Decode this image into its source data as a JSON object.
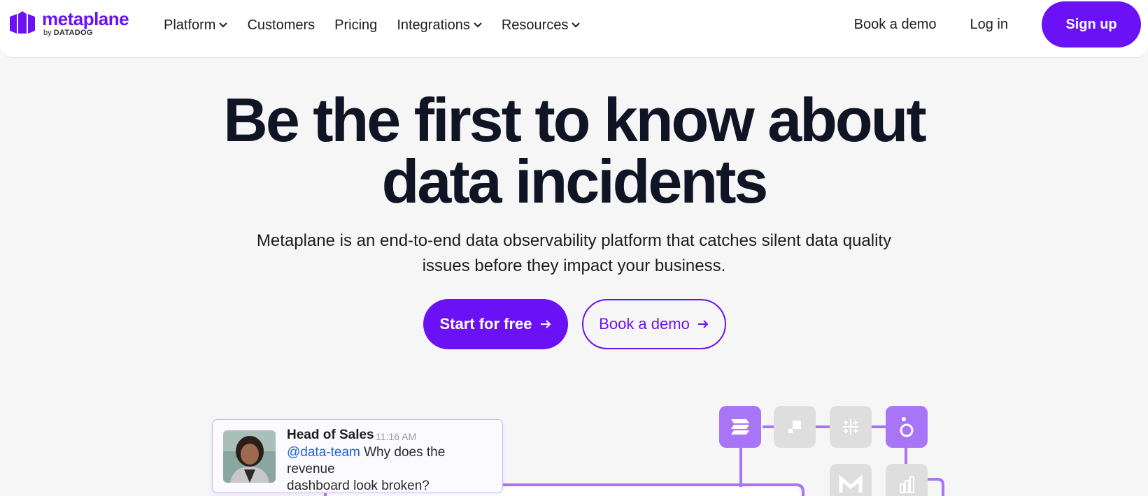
{
  "nav": {
    "logo_name": "metaplane",
    "logo_by": "by",
    "logo_brand": "DATADOG",
    "links": [
      {
        "label": "Platform",
        "dropdown": true
      },
      {
        "label": "Customers",
        "dropdown": false
      },
      {
        "label": "Pricing",
        "dropdown": false
      },
      {
        "label": "Integrations",
        "dropdown": true
      },
      {
        "label": "Resources",
        "dropdown": true
      }
    ],
    "book_demo": "Book a demo",
    "login": "Log in",
    "signup": "Sign up"
  },
  "hero": {
    "title_line1": "Be the first to know about",
    "title_line2": "data incidents",
    "subtitle_line1": "Metaplane is an end-to-end data observability platform that catches silent data quality",
    "subtitle_line2": "issues before they impact your business.",
    "cta_primary": "Start for free",
    "cta_secondary": "Book a demo"
  },
  "message": {
    "author": "Head of Sales",
    "time": "11:16 AM",
    "mention": "@data-team",
    "text_rest": " Why does the revenue",
    "text_line2": "dashboard look broken?"
  },
  "colors": {
    "brand": "#6a12f5",
    "tile_active": "#a875f7",
    "tile_idle": "#dededf",
    "mention": "#1d64d8"
  },
  "icons": [
    "metaplane-logo-icon",
    "chevron-down-icon",
    "arrow-right-icon",
    "integration-tiles"
  ]
}
